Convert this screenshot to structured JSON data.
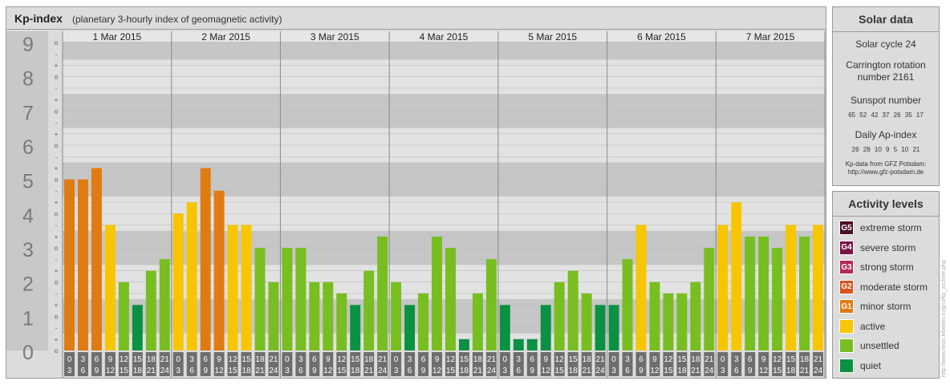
{
  "title": {
    "main": "Kp-index",
    "sub": "(planetary 3-hourly index of geomagnetic activity)"
  },
  "chart_data": {
    "type": "bar",
    "days": [
      "1 Mar 2015",
      "2 Mar 2015",
      "3 Mar 2015",
      "4 Mar 2015",
      "5 Mar 2015",
      "6 Mar 2015",
      "7 Mar 2015"
    ],
    "interval_starts": [
      "0",
      "3",
      "6",
      "9",
      "12",
      "15",
      "18",
      "21"
    ],
    "interval_ends": [
      "3",
      "6",
      "9",
      "12",
      "15",
      "18",
      "21",
      "24"
    ],
    "y_ticks": [
      "0",
      "1",
      "2",
      "3",
      "4",
      "5",
      "6",
      "7",
      "8",
      "9"
    ],
    "y_minor_labels": [
      "-",
      "o",
      "+"
    ],
    "ylim": [
      0,
      9.33
    ],
    "values": [
      5.0,
      5.0,
      5.33,
      3.67,
      2.0,
      1.33,
      2.33,
      2.67,
      4.0,
      4.33,
      5.33,
      4.67,
      3.67,
      3.67,
      3.0,
      2.0,
      3.0,
      3.0,
      2.0,
      2.0,
      1.67,
      1.33,
      2.33,
      3.33,
      2.0,
      1.33,
      1.67,
      3.33,
      3.0,
      0.33,
      1.67,
      2.67,
      1.33,
      0.33,
      0.33,
      1.33,
      2.0,
      2.33,
      1.67,
      1.33,
      1.33,
      2.67,
      3.67,
      2.0,
      1.67,
      1.67,
      2.0,
      3.0,
      3.67,
      4.33,
      3.33,
      3.33,
      3.0,
      3.67,
      3.33,
      3.67
    ],
    "colors": {
      "quiet": "#0a9142",
      "unsettled": "#78be20",
      "active": "#f7c600",
      "G1": "#e07b12",
      "G2": "#d9531e",
      "G3": "#b22a58",
      "G4": "#7a1446",
      "G5": "#4a0f2a"
    },
    "grid": true
  },
  "solar": {
    "title": "Solar data",
    "cycle": "Solar cycle 24",
    "carrington": "Carrington rotation number 2161",
    "sunspot_title": "Sunspot number",
    "sunspot_values": "65 52 42 37 26 35 17",
    "ap_title": "Daily Ap-index",
    "ap_values": "26 28 10 9 5 10 21",
    "source": "Kp-data from GFZ Potsdam:",
    "source_url": "http://www.gfz-potsdam.de"
  },
  "levels": {
    "title": "Activity levels",
    "items": [
      {
        "code": "G5",
        "label": "extreme storm",
        "color": "#4a0f2a"
      },
      {
        "code": "G4",
        "label": "severe storm",
        "color": "#7a1446"
      },
      {
        "code": "G3",
        "label": "strong storm",
        "color": "#b22a58"
      },
      {
        "code": "G2",
        "label": "moderate storm",
        "color": "#d9531e"
      },
      {
        "code": "G1",
        "label": "minor storm",
        "color": "#e07b12"
      },
      {
        "code": "",
        "label": "active",
        "color": "#f7c600"
      },
      {
        "code": "",
        "label": "unsettled",
        "color": "#78be20"
      },
      {
        "code": "",
        "label": "quiet",
        "color": "#0a9142"
      }
    ]
  },
  "watermark": "http://www.tesis.lebedev.ru/gnu/kp_archive.php"
}
